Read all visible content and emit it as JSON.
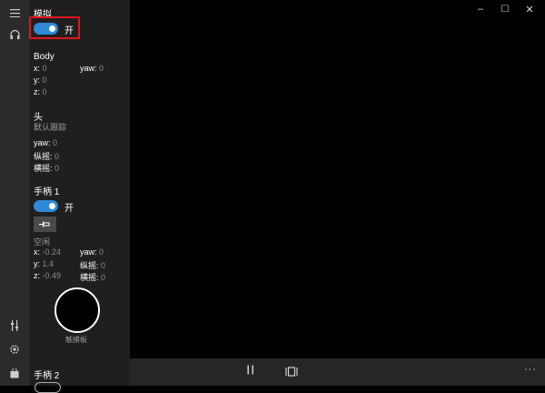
{
  "rail": {
    "icons": [
      "hamburger-icon",
      "headset-icon",
      "controller-settings-icon",
      "gear-icon",
      "store-icon"
    ]
  },
  "panel": {
    "simulate": {
      "title": "模拟",
      "toggle_label": "开"
    },
    "body": {
      "title": "Body",
      "x": "x:",
      "x_val": "0",
      "yaw": "yaw:",
      "yaw_val": "0",
      "y": "y:",
      "y_val": "0",
      "z": "z:",
      "z_val": "0"
    },
    "head": {
      "title": "头",
      "mode": "默认跟踪",
      "yaw": "yaw:",
      "yaw_val": "0",
      "pitch": "纵摇:",
      "pitch_val": "0",
      "roll": "横摇:",
      "roll_val": "0"
    },
    "controller1": {
      "title": "手柄 1",
      "toggle_label": "开",
      "state": "空闲",
      "x": "x:",
      "x_val": "-0.24",
      "yaw": "yaw:",
      "yaw_val": "0",
      "y": "y:",
      "y_val": "1.4",
      "pitch": "纵摇:",
      "pitch_val": "0",
      "z": "z:",
      "z_val": "-0.49",
      "roll": "横摇:",
      "roll_val": "0",
      "touchpad_label": "触摸板"
    },
    "controller2": {
      "title": "手柄 2"
    }
  },
  "window": {
    "minimize": "–",
    "maximize": "☐",
    "close": "✕"
  },
  "bottombar": {
    "pause": "⏸",
    "fit": "[▯]",
    "more": "···"
  }
}
